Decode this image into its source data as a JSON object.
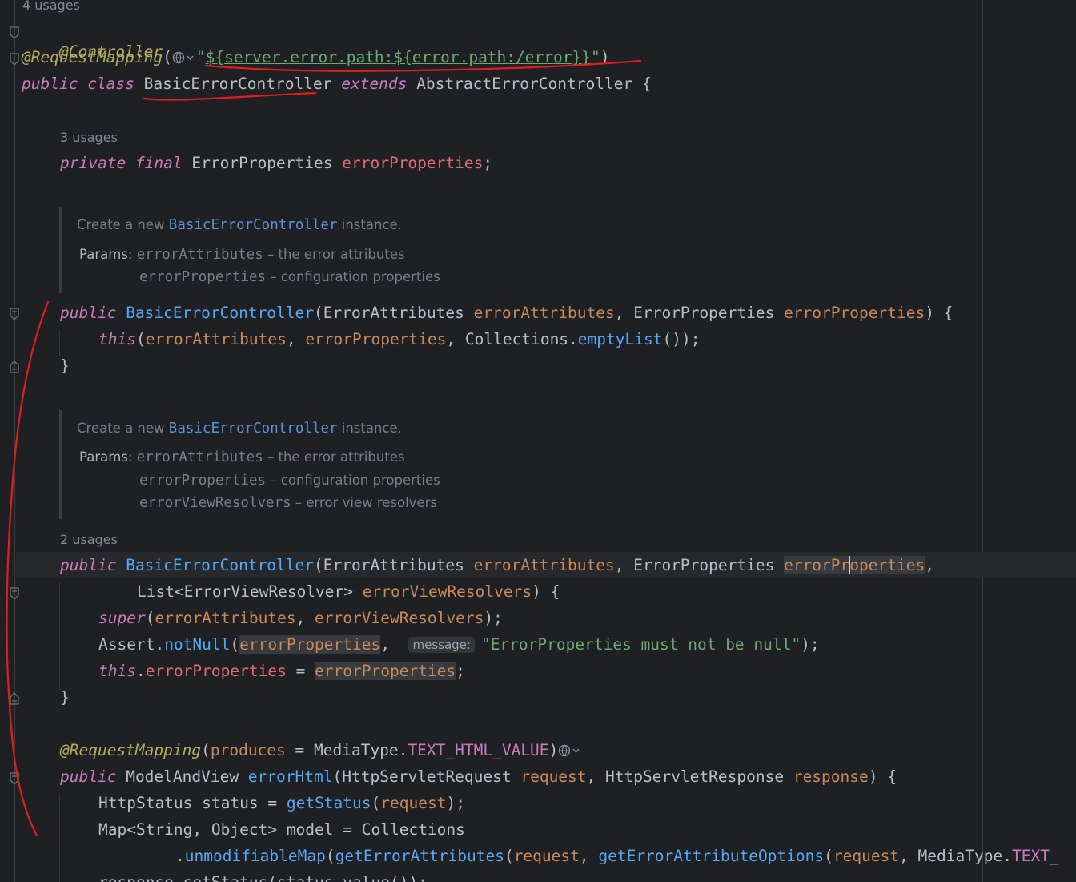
{
  "usages": {
    "class": "4 usages",
    "field": "3 usages",
    "constructor2": "2 usages"
  },
  "code": {
    "ann_controller": "@Controller",
    "ann_request_mapping": "@RequestMapping",
    "request_mapping_path": "${server.error.path:${error.path:/error}}",
    "kw_public": "public",
    "kw_class": "class",
    "kw_extends": "extends",
    "kw_private": "private",
    "kw_final": "final",
    "kw_this": "this",
    "kw_super": "super",
    "class_name": "BasicErrorController",
    "super_class": "AbstractErrorController",
    "type_error_properties": "ErrorProperties",
    "type_error_attributes": "ErrorAttributes",
    "type_list_resolvers": "List<ErrorViewResolver>",
    "field_error_properties": "errorProperties",
    "param_error_attributes": "errorAttributes",
    "param_error_properties": "errorProperties",
    "param_error_view_resolvers": "errorViewResolvers",
    "collections": "Collections",
    "empty_list": "emptyList",
    "assert": "Assert",
    "not_null": "notNull",
    "inlay_message": "message:",
    "assert_message": "\"ErrorProperties must not be null\"",
    "produces": "produces",
    "media_type": "MediaType",
    "text_html_value": "TEXT_HTML_VALUE",
    "model_and_view": "ModelAndView",
    "error_html": "errorHtml",
    "http_servlet_request": "HttpServletRequest",
    "request": "request",
    "http_servlet_response": "HttpServletResponse",
    "response": "response",
    "http_status": "HttpStatus",
    "status": "status",
    "get_status": "getStatus",
    "map_type": "Map<String, Object>",
    "model": "model",
    "unmodifiable_map": "unmodifiableMap",
    "get_error_attributes": "getErrorAttributes",
    "get_error_attribute_options": "getErrorAttributeOptions",
    "text_trunc": "TEXT_",
    "last_line": "response.setStatus(status.value());"
  },
  "docs": {
    "create_a_new": "Create a new",
    "instance": "instance.",
    "params_label": "Params:",
    "desc_error_attributes": "– the error attributes",
    "desc_error_properties": "– configuration properties",
    "desc_error_view_resolvers": "– error view resolvers"
  }
}
